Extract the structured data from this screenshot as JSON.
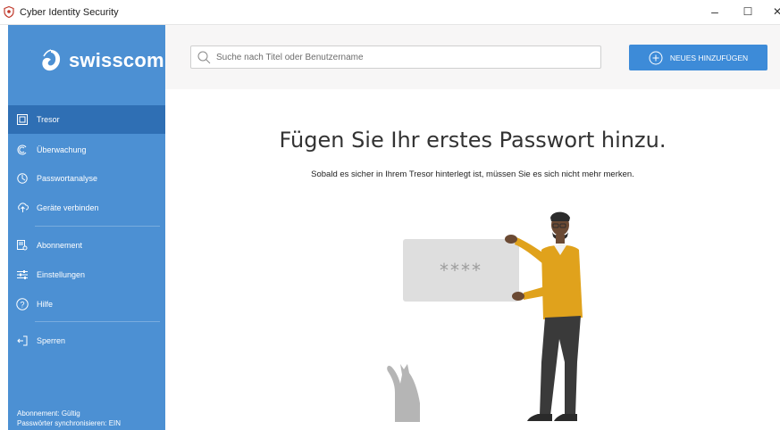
{
  "window": {
    "title": "Cyber Identity Security",
    "minimize": "–",
    "maximize": "☐",
    "close": "✕"
  },
  "brand": {
    "name": "swisscom"
  },
  "sidebar": {
    "items": [
      {
        "label": "Tresor",
        "icon": "vault-icon",
        "active": true
      },
      {
        "label": "Überwachung",
        "icon": "monitor-icon"
      },
      {
        "label": "Passwortanalyse",
        "icon": "analysis-icon"
      },
      {
        "label": "Geräte verbinden",
        "icon": "connect-devices-icon"
      },
      {
        "label": "Abonnement",
        "icon": "subscription-icon"
      },
      {
        "label": "Einstellungen",
        "icon": "settings-sliders-icon"
      },
      {
        "label": "Hilfe",
        "icon": "help-icon"
      },
      {
        "label": "Sperren",
        "icon": "lock-exit-icon"
      }
    ],
    "status_subscription": "Abonnement: Gültig",
    "status_sync": "Passwörter synchronisieren: EIN"
  },
  "search": {
    "placeholder": "Suche nach Titel oder Benutzername",
    "value": ""
  },
  "toolbar": {
    "add_label": "NEUES HINZUFÜGEN"
  },
  "main": {
    "title": "Fügen Sie Ihr erstes Passwort hinzu.",
    "subtitle": "Sobald es sicher in Ihrem Tresor hinterlegt ist, müssen Sie es sich nicht mehr merken.",
    "card_text": "****"
  },
  "colors": {
    "sidebar": "#4c90d3",
    "sidebar_active": "#2f6fb4",
    "accent_button": "#3d8bd8",
    "topbar": "#f7f6f6"
  }
}
